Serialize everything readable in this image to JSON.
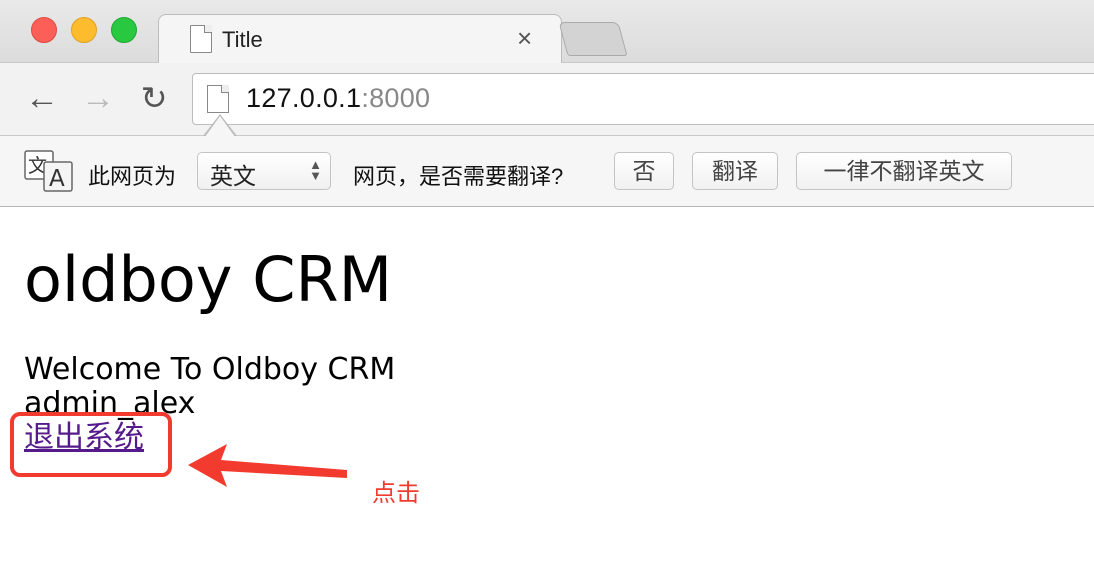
{
  "browser": {
    "tab_title": "Title",
    "tab_close_icon": "close-icon",
    "url_host": "127.0.0.1",
    "url_port": ":8000"
  },
  "translate_bar": {
    "prefix": "此网页为",
    "language": "英文",
    "question": "网页，是否需要翻译?",
    "buttons": {
      "no": "否",
      "translate": "翻译",
      "never": "一律不翻译英文"
    },
    "icon_glyph_small": "文",
    "icon_glyph_large": "A"
  },
  "page": {
    "title": "oldboy CRM",
    "welcome": "Welcome To Oldboy CRM",
    "username": "admin_alex",
    "logout_link": "退出系统"
  },
  "annotation": {
    "label": "点击",
    "color": "#f23b2e"
  }
}
